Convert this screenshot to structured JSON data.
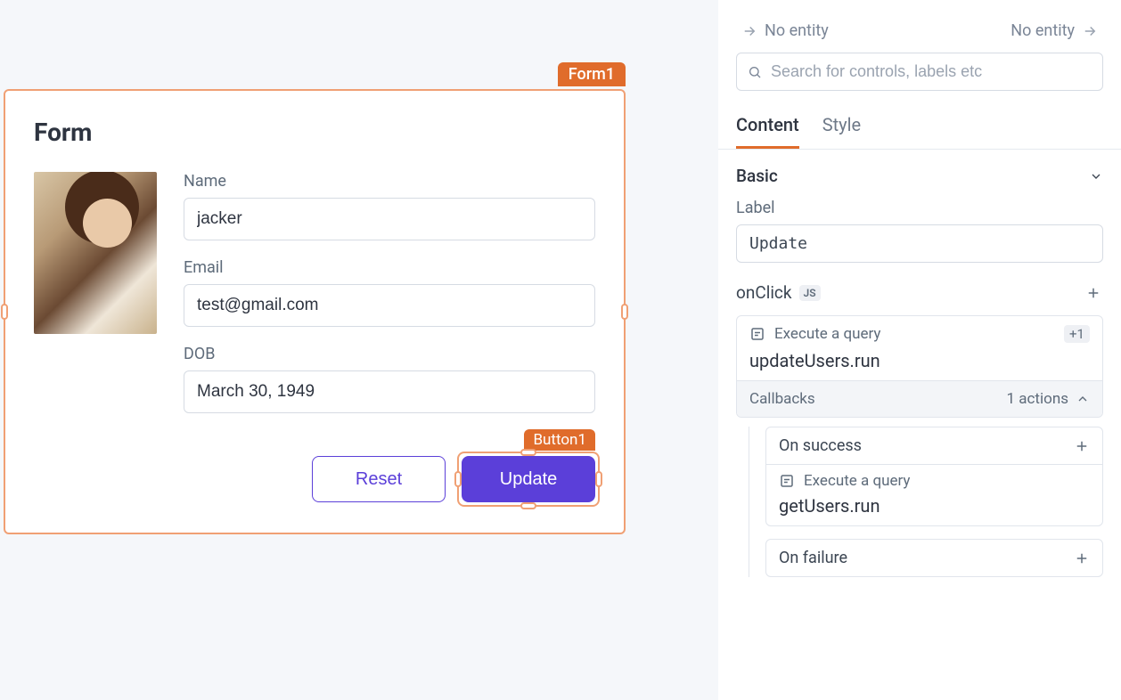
{
  "canvas": {
    "form_tag": "Form1",
    "form_title": "Form",
    "fields": {
      "name_label": "Name",
      "name_value": "jacker",
      "email_label": "Email",
      "email_value": "test@gmail.com",
      "dob_label": "DOB",
      "dob_value": "March 30, 1949"
    },
    "buttons": {
      "reset": "Reset",
      "update": "Update",
      "update_tag": "Button1"
    }
  },
  "panel": {
    "entity_prev": "No entity",
    "entity_next": "No entity",
    "search_placeholder": "Search for controls, labels etc",
    "tabs": {
      "content": "Content",
      "style": "Style"
    },
    "basic_section": "Basic",
    "label_prop": "Label",
    "label_value": "Update",
    "onclick": "onClick",
    "js_badge": "JS",
    "action": {
      "title": "Execute a query",
      "count_badge": "+1",
      "code": "updateUsers.run",
      "callbacks_label": "Callbacks",
      "callbacks_count": "1 actions"
    },
    "on_success": "On success",
    "success_action_title": "Execute a query",
    "success_action_code": "getUsers.run",
    "on_failure": "On failure"
  }
}
